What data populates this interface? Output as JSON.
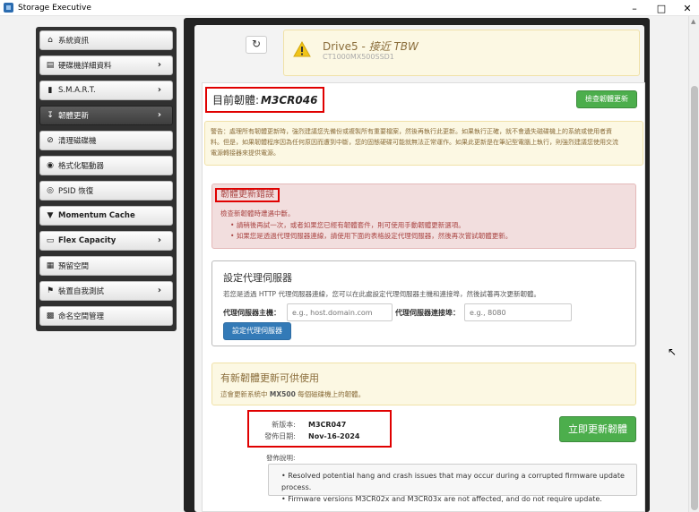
{
  "window": {
    "title": "Storage Executive"
  },
  "sidebar": {
    "items": [
      {
        "label": "系統資訊",
        "icon": "home-icon",
        "has_chevron": false
      },
      {
        "label": "硬碟機詳細資料",
        "icon": "drive-icon",
        "has_chevron": true
      },
      {
        "label": "S.M.A.R.T.",
        "icon": "bar-chart-icon",
        "has_chevron": true
      },
      {
        "label": "韌體更新",
        "icon": "download-icon",
        "has_chevron": true,
        "active": true
      },
      {
        "label": "清理磁碟機",
        "icon": "ban-icon",
        "has_chevron": false
      },
      {
        "label": "格式化驅動器",
        "icon": "disc-icon",
        "has_chevron": false
      },
      {
        "label": "PSID 恢復",
        "icon": "eye-icon",
        "has_chevron": false
      },
      {
        "label": "Momentum Cache",
        "icon": "filter-icon",
        "has_chevron": false
      },
      {
        "label": "Flex Capacity",
        "icon": "flex-icon",
        "has_chevron": true
      },
      {
        "label": "預留空間",
        "icon": "grid-icon",
        "has_chevron": false
      },
      {
        "label": "裝置自我測試",
        "icon": "flag-icon",
        "has_chevron": true
      },
      {
        "label": "命名空間管理",
        "icon": "namespace-icon",
        "has_chevron": false
      }
    ]
  },
  "drive": {
    "name": "Drive5",
    "separator": " - ",
    "tbw": "接近 TBW",
    "model": "CT1000MX500SSD1"
  },
  "firmware": {
    "current_label": "目前韌體:",
    "current_value": "M3CR046",
    "check_button": "檢查韌體更新",
    "warning_line1": "警告：處理所有韌體更新時，強烈建議您先備份或複製所有重要檔案，然後再執行此更新。如果執行正確，就不會遺失磁碟機上的系統或使用者資",
    "warning_line2": "料。但是，如果韌體程序因為任何原因而遭到中斷，您的固態硬碟可能就無法正常運作。如果此更新是在筆記型電腦上執行，則強烈建議您使用交流",
    "warning_line3": "電源轉接器來提供電源。"
  },
  "error": {
    "title": "韌體更新錯誤",
    "desc": "檢查新韌體時遭遇中斷。",
    "items": [
      "請稍後再試一次，或者如果您已經有韌體套件，則可使用手動韌體更新選項。",
      "如果您是透過代理伺服器連線，請使用下面的表格設定代理伺服器，然後再次嘗試韌體更新。"
    ]
  },
  "proxy": {
    "title": "設定代理伺服器",
    "desc": "若您是透過 HTTP 代理伺服器連線，您可以在此處設定代理伺服器主機和連接埠，然後試著再次更新韌體。",
    "host_label": "代理伺服器主機：",
    "host_placeholder": "e.g., host.domain.com",
    "port_label": "代理伺服器連接埠：",
    "port_placeholder": "e.g., 8080",
    "button": "設定代理伺服器"
  },
  "update": {
    "title": "有新韌體更新可供使用",
    "desc_prefix": "這會更新系統中 ",
    "desc_model": "MX500",
    "desc_suffix": " 每個磁碟機上的韌體。",
    "new_version_label": "新版本:",
    "new_version_value": "M3CR047",
    "release_date_label": "發佈日期:",
    "release_date_value": "Nov-16-2024",
    "update_now_button": "立即更新韌體",
    "notes_label": "發佈說明:",
    "notes": [
      "Resolved potential hang and crash issues that may occur during a corrupted firmware update process.",
      "Firmware versions M3CR02x and M3CR03x are not affected, and do not require update."
    ]
  },
  "colors": {
    "accent_green": "#4cae4c",
    "accent_blue": "#337ab7",
    "highlight_red": "#e00000",
    "sidebar_bg": "#303030"
  }
}
